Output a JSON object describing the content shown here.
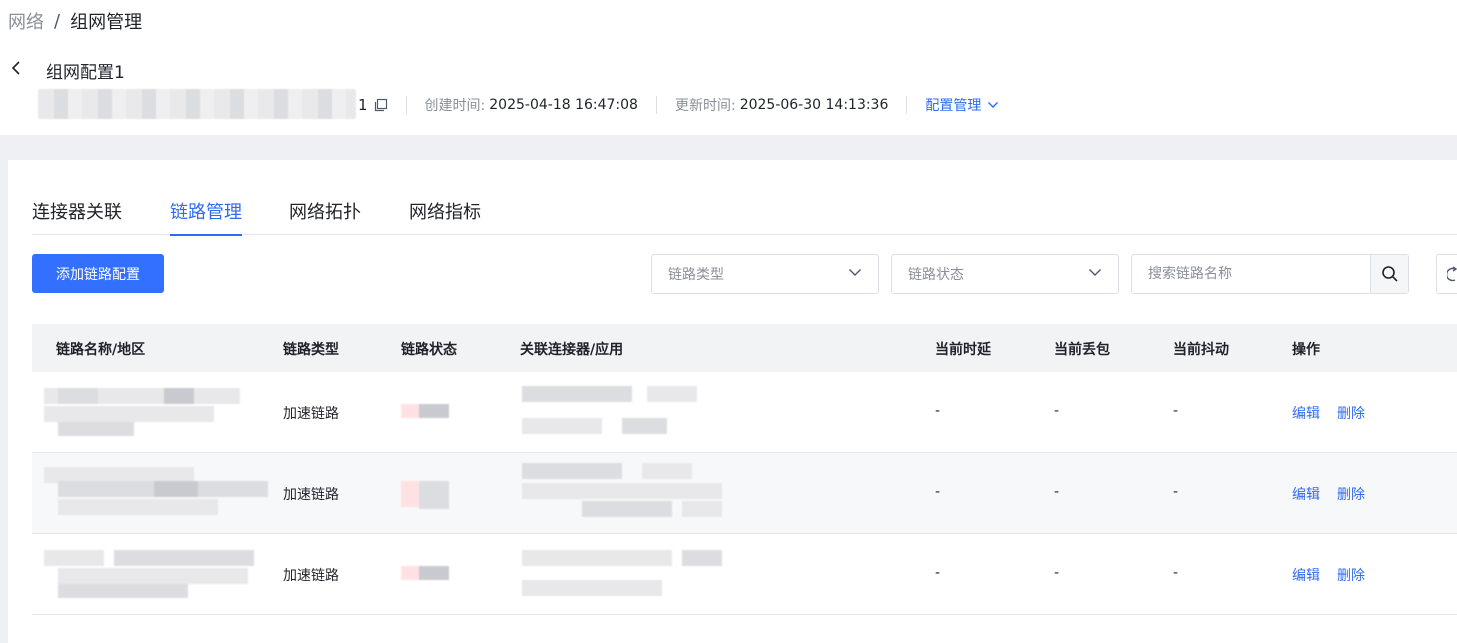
{
  "breadcrumb": {
    "parent": "网络",
    "separator": "/",
    "current": "组网管理"
  },
  "header": {
    "title": "组网配置1",
    "id_suffix": "1",
    "created_label": "创建时间:",
    "created_value": "2025-04-18 16:47:08",
    "updated_label": "更新时间:",
    "updated_value": "2025-06-30 14:13:36",
    "config_menu": "配置管理"
  },
  "tabs": [
    {
      "label": "连接器关联",
      "active": false
    },
    {
      "label": "链路管理",
      "active": true
    },
    {
      "label": "网络拓扑",
      "active": false
    },
    {
      "label": "网络指标",
      "active": false
    }
  ],
  "toolbar": {
    "add_button": "添加链路配置",
    "type_select_placeholder": "链路类型",
    "status_select_placeholder": "链路状态",
    "search_placeholder": "搜索链路名称"
  },
  "table": {
    "columns": [
      "链路名称/地区",
      "链路类型",
      "链路状态",
      "关联连接器/应用",
      "当前时延",
      "当前丢包",
      "当前抖动",
      "操作"
    ],
    "rows": [
      {
        "type": "加速链路",
        "latency": "-",
        "loss": "-",
        "jitter": "-",
        "edit": "编辑",
        "delete": "删除"
      },
      {
        "type": "加速链路",
        "latency": "-",
        "loss": "-",
        "jitter": "-",
        "edit": "编辑",
        "delete": "删除"
      },
      {
        "type": "加速链路",
        "latency": "-",
        "loss": "-",
        "jitter": "-",
        "edit": "编辑",
        "delete": "删除"
      }
    ]
  },
  "colors": {
    "primary": "#3370ff",
    "link": "#2f6bf0",
    "header_bg": "#f2f3f5",
    "page_bg": "#eef0f3"
  },
  "icons": [
    "chevron-left-icon",
    "copy-icon",
    "chevron-down-icon",
    "search-icon",
    "refresh-icon"
  ]
}
